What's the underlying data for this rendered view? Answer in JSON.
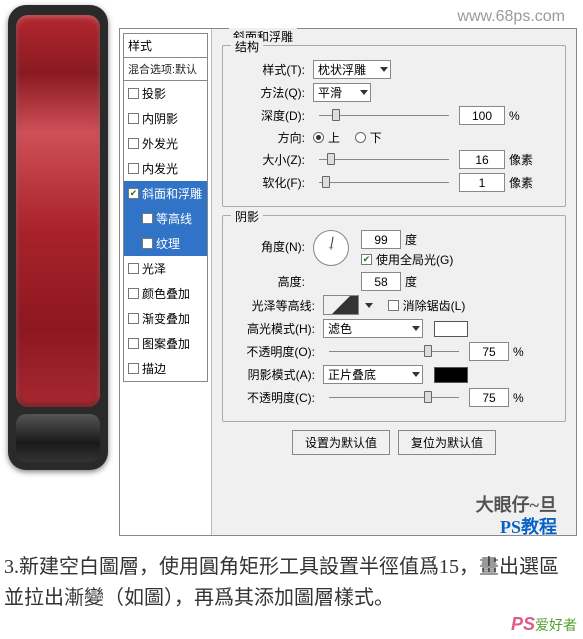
{
  "url": "www.68ps.com",
  "styles_panel": {
    "header": "样式",
    "blend_default": "混合选项:默认",
    "items": [
      {
        "label": "投影",
        "checked": false
      },
      {
        "label": "内阴影",
        "checked": false
      },
      {
        "label": "外发光",
        "checked": false
      },
      {
        "label": "内发光",
        "checked": false
      },
      {
        "label": "斜面和浮雕",
        "checked": true,
        "selected": true
      },
      {
        "label": "等高线",
        "checked": false,
        "sub": true,
        "selected": true
      },
      {
        "label": "纹理",
        "checked": false,
        "sub": true,
        "selected": true
      },
      {
        "label": "光泽",
        "checked": false
      },
      {
        "label": "颜色叠加",
        "checked": false
      },
      {
        "label": "渐变叠加",
        "checked": false
      },
      {
        "label": "图案叠加",
        "checked": false
      },
      {
        "label": "描边",
        "checked": false
      }
    ]
  },
  "main_title": "斜面和浮雕",
  "structure": {
    "title": "结构",
    "style_label": "样式(T):",
    "style_value": "枕状浮雕",
    "method_label": "方法(Q):",
    "method_value": "平滑",
    "depth_label": "深度(D):",
    "depth_value": "100",
    "depth_unit": "%",
    "direction_label": "方向:",
    "up": "上",
    "down": "下",
    "size_label": "大小(Z):",
    "size_value": "16",
    "size_unit": "像素",
    "soften_label": "软化(F):",
    "soften_value": "1",
    "soften_unit": "像素"
  },
  "shading": {
    "title": "阴影",
    "angle_label": "角度(N):",
    "angle_value": "99",
    "angle_unit": "度",
    "global_label": "使用全局光(G)",
    "altitude_label": "高度:",
    "altitude_value": "58",
    "altitude_unit": "度",
    "contour_label": "光泽等高线:",
    "antialias_label": "消除锯齿(L)",
    "hmode_label": "高光模式(H):",
    "hmode_value": "滤色",
    "hopacity_label": "不透明度(O):",
    "hopacity_value": "75",
    "pct": "%",
    "smode_label": "阴影模式(A):",
    "smode_value": "正片叠底",
    "sopacity_label": "不透明度(C):",
    "sopacity_value": "75"
  },
  "buttons": {
    "default": "设置为默认值",
    "reset": "复位为默认值"
  },
  "tutorial": "3.新建空白圖層，使用圓角矩形工具設置半徑值爲15，畫出選區並拉出漸變（如圖），再爲其添加圖層樣式。",
  "watermarks": {
    "w1": "大眼仔~旦",
    "w2": "PS教程",
    "w3a": "PS",
    "w3b": "爱好者"
  }
}
